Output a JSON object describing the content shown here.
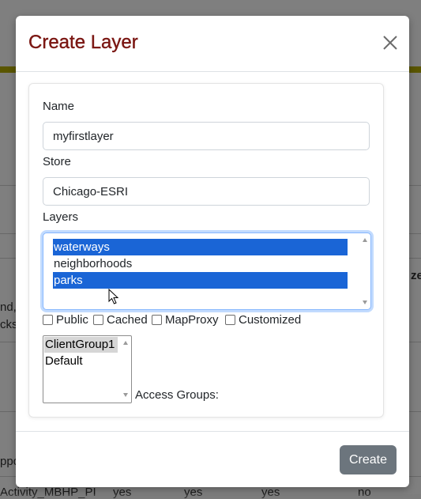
{
  "background": {
    "text_left_1": "nd,",
    "text_left_2": "cks_",
    "text_right": "ze",
    "text_bottom_left": "ppo",
    "row_partial": [
      "Activity_MBHP_PI",
      "yes",
      "yes",
      "yes",
      "no"
    ]
  },
  "modal": {
    "title": "Create Layer",
    "name_label": "Name",
    "name_value": "myfirstlayer",
    "store_label": "Store",
    "store_value": "Chicago-ESRI",
    "layers_label": "Layers",
    "layers_options": [
      {
        "label": "waterways",
        "selected": true
      },
      {
        "label": "neighborhoods",
        "selected": false
      },
      {
        "label": "parks",
        "selected": true
      }
    ],
    "checkboxes": [
      {
        "label": "Public",
        "checked": false
      },
      {
        "label": "Cached",
        "checked": false
      },
      {
        "label": "MapProxy",
        "checked": false
      },
      {
        "label": "Customized",
        "checked": false
      }
    ],
    "access_groups_options": [
      {
        "label": "ClientGroup1",
        "selected": true
      },
      {
        "label": "Default",
        "selected": false
      }
    ],
    "access_groups_label": "Access Groups:",
    "create_label": "Create"
  },
  "colors": {
    "title": "#7b1713",
    "selection": "#1a65d6",
    "create_button": "#6c757d",
    "focus_border": "#86b7fe"
  },
  "icons": {
    "close": "close-icon",
    "cursor": "mouse-pointer-icon"
  }
}
